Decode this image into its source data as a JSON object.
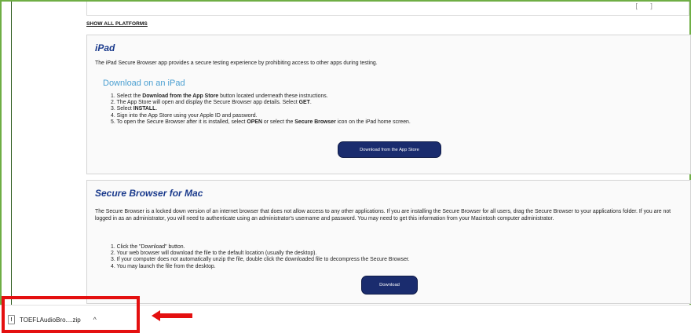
{
  "header": {
    "brackets": "[ ]"
  },
  "show_all_platforms": "SHOW ALL PLATFORMS",
  "ipad": {
    "title": "iPad",
    "description": "The iPad Secure Browser app provides a secure testing experience by prohibiting access to other apps during testing.",
    "subheading": "Download on an iPad",
    "steps": [
      [
        "1. Select the ",
        "Download from the App Store",
        " button located underneath these instructions."
      ],
      [
        "2. The App Store will open and display the Secure Browser app details. Select ",
        "GET",
        "."
      ],
      [
        "3. Select ",
        "INSTALL",
        "."
      ],
      [
        "4. Sign into the App Store using your Apple ID and password.",
        "",
        ""
      ],
      [
        "5. To open the Secure Browser after it is installed, select ",
        "OPEN",
        " or select the "
      ]
    ],
    "step5_bold2": "Secure Browser",
    "step5_tail": " icon on the iPad home screen.",
    "button_label": "Download from the App Store"
  },
  "mac": {
    "title": "Secure Browser for Mac",
    "description": "The Secure Browser is a locked down version of an internet browser that does not allow access to any other applications. If you are installing the Secure Browser for all users, drag the Secure Browser to your applications folder. If you are not logged in as an administrator, you will need to authenticate using an administrator's username and password. You may need to get this information from your Macintosh computer administrator.",
    "steps": [
      "1. Click the \"Download\" button.",
      "2. Your web browser will download the file to the default location (usually the desktop).",
      "3. If your computer does not automatically unzip the file, double click the downloaded file to decompress the Secure Browser.",
      "4. You may launch the file from the desktop."
    ],
    "button_label": "Download"
  },
  "download_bar": {
    "filename": "TOEFLAudioBro....zip",
    "file_icon": "!",
    "chevron": "^"
  },
  "colors": {
    "frame": "#6fae45",
    "title": "#1a3a8c",
    "subheading": "#4a9fd1",
    "button": "#1a2c6e",
    "highlight": "#e41010"
  }
}
